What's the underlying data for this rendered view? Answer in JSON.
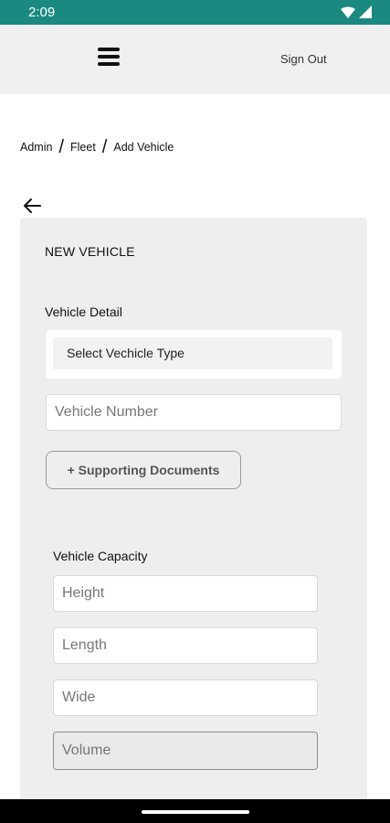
{
  "status_bar": {
    "time": "2:09"
  },
  "header": {
    "sign_out_label": "Sign Out"
  },
  "breadcrumb": {
    "items": [
      "Admin",
      "Fleet",
      "Add Vehicle"
    ]
  },
  "form": {
    "title": "NEW VEHICLE",
    "vehicle_detail_label": "Vehicle Detail",
    "vehicle_type_select": "Select Vechicle Type",
    "vehicle_number_placeholder": "Vehicle Number",
    "supporting_documents_label": "+ Supporting Documents",
    "capacity_label": "Vehicle Capacity",
    "height_placeholder": "Height",
    "length_placeholder": "Length",
    "wide_placeholder": "Wide",
    "volume_placeholder": "Volume"
  },
  "icons": {
    "menu": "hamburger-icon",
    "back": "arrow-left-icon",
    "wifi": "wifi-icon",
    "signal": "signal-icon"
  },
  "colors": {
    "status_bar": "#1a8a80"
  }
}
